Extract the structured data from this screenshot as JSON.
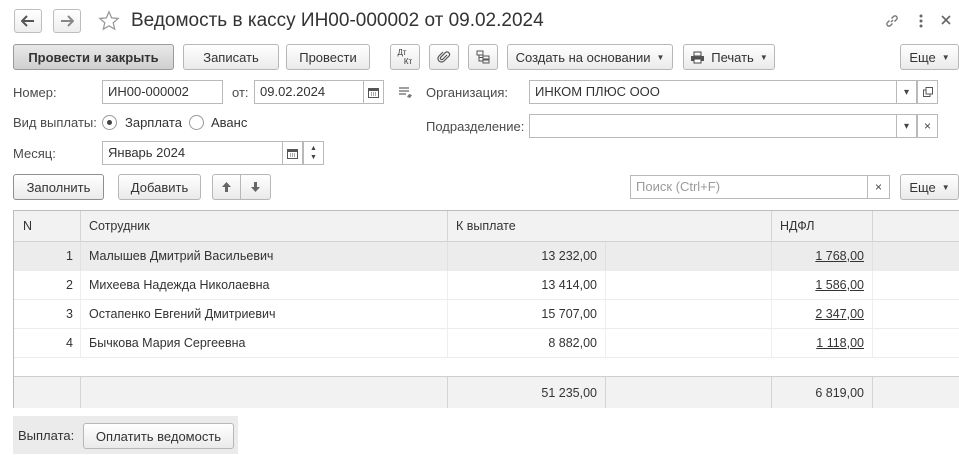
{
  "window": {
    "title": "Ведомость в кассу ИН00-000002 от 09.02.2024",
    "back_icon": "arrow-left-icon",
    "forward_icon": "arrow-right-icon"
  },
  "toolbar": {
    "post_close_label": "Провести и закрыть",
    "save_label": "Записать",
    "post_label": "Провести",
    "dt_kt_label_top": "Дт",
    "dt_kt_label_bottom": "Кт",
    "create_based_label": "Создать на основании",
    "print_label": "Печать",
    "more_label": "Еще"
  },
  "form": {
    "number_label": "Номер:",
    "number_value": "ИН00-000002",
    "date_label": "от:",
    "date_value": "09.02.2024",
    "org_label": "Организация:",
    "org_value": "ИНКОМ ПЛЮС ООО",
    "payment_type_label": "Вид выплаты:",
    "payment_options": [
      "Зарплата",
      "Аванс"
    ],
    "payment_selected": "Зарплата",
    "dept_label": "Подразделение:",
    "dept_value": "",
    "month_label": "Месяц:",
    "month_value": "Январь 2024"
  },
  "table_toolbar": {
    "fill_label": "Заполнить",
    "add_label": "Добавить",
    "search_placeholder": "Поиск (Ctrl+F)",
    "more_label": "Еще"
  },
  "table": {
    "columns": [
      "N",
      "Сотрудник",
      "К выплате",
      "НДФЛ"
    ],
    "rows": [
      {
        "n": "1",
        "employee": "Малышев Дмитрий Васильевич",
        "amount": "13 232,00",
        "ndfl": "1 768,00"
      },
      {
        "n": "2",
        "employee": "Михеева Надежда Николаевна",
        "amount": "13 414,00",
        "ndfl": "1 586,00"
      },
      {
        "n": "3",
        "employee": "Остапенко Евгений Дмитриевич",
        "amount": "15 707,00",
        "ndfl": "2 347,00"
      },
      {
        "n": "4",
        "employee": "Бычкова Мария Сергеевна",
        "amount": "8 882,00",
        "ndfl": "1 118,00"
      }
    ],
    "totals": {
      "amount": "51 235,00",
      "ndfl": "6 819,00"
    }
  },
  "footer": {
    "payment_label": "Выплата:",
    "pay_button_label": "Оплатить ведомость"
  }
}
